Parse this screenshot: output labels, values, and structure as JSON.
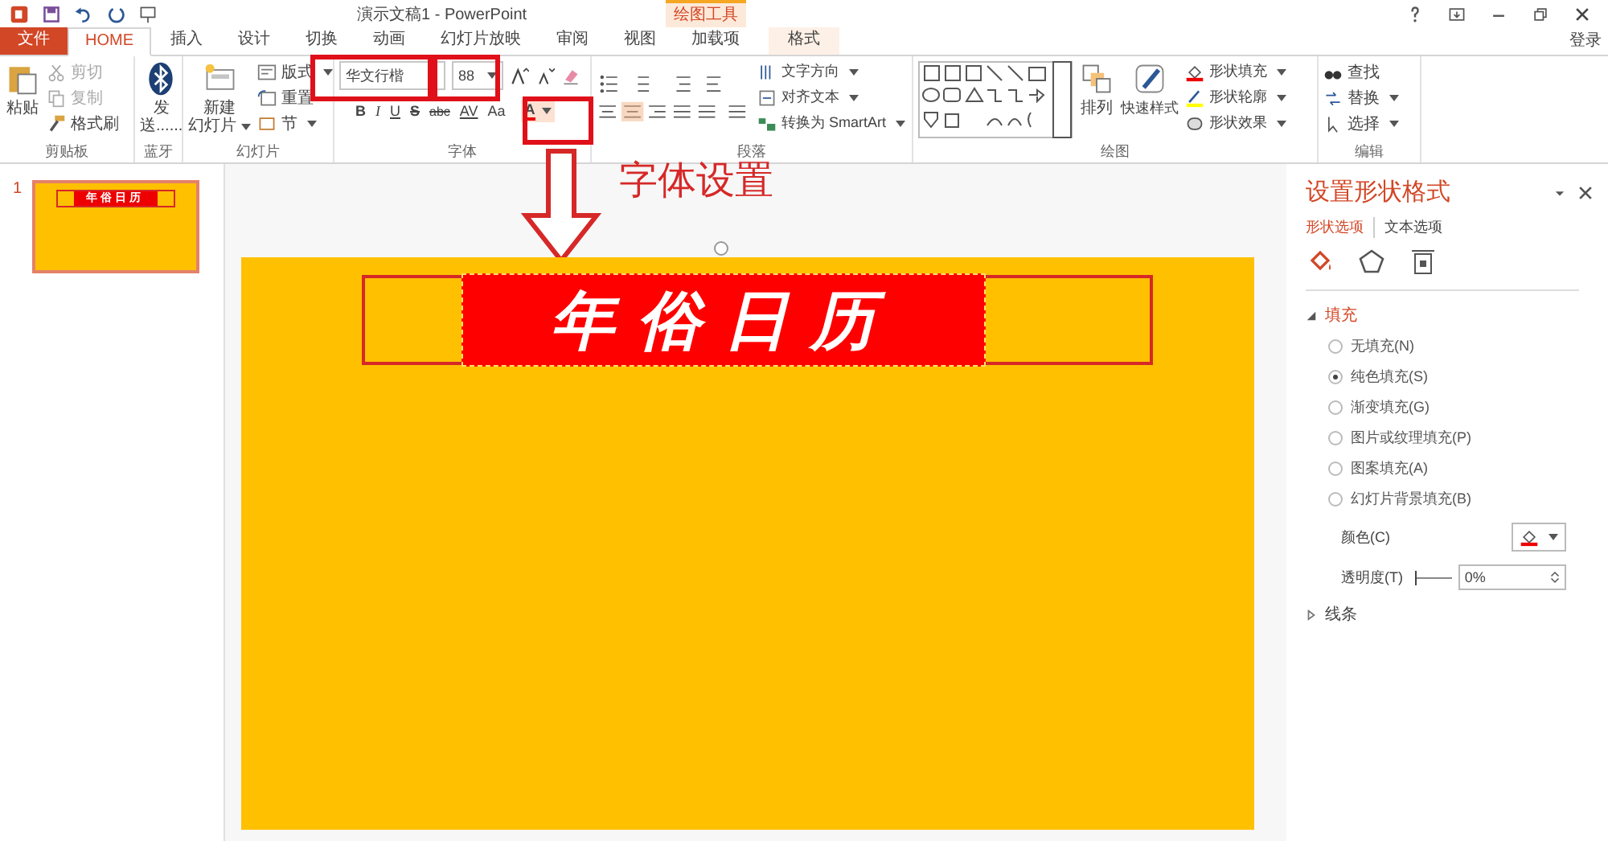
{
  "title_bar": {
    "title": "演示文稿1 - PowerPoint",
    "contextual_header": "绘图工具",
    "login": "登录"
  },
  "tabs": [
    {
      "label": "文件",
      "kind": "file",
      "selected": false
    },
    {
      "label": "HOME",
      "kind": "normal",
      "selected": true
    },
    {
      "label": "插入",
      "kind": "normal",
      "selected": false
    },
    {
      "label": "设计",
      "kind": "normal",
      "selected": false
    },
    {
      "label": "切换",
      "kind": "normal",
      "selected": false
    },
    {
      "label": "动画",
      "kind": "normal",
      "selected": false
    },
    {
      "label": "幻灯片放映",
      "kind": "normal",
      "selected": false
    },
    {
      "label": "审阅",
      "kind": "normal",
      "selected": false
    },
    {
      "label": "视图",
      "kind": "normal",
      "selected": false
    },
    {
      "label": "加载项",
      "kind": "normal",
      "selected": false
    },
    {
      "label": "格式",
      "kind": "contextual",
      "selected": false
    }
  ],
  "ribbon": {
    "clipboard": {
      "label": "剪贴板",
      "paste": "粘贴",
      "cut": "剪切",
      "copy": "复制",
      "format_painter": "格式刷"
    },
    "bluetooth": {
      "label": "蓝牙",
      "send": "发",
      "send_more": "送......"
    },
    "slides": {
      "label": "幻灯片",
      "new_slide": "新建",
      "new_slide_2": "幻灯片",
      "layout": "版式",
      "reset": "重置",
      "section": "节"
    },
    "font": {
      "label": "字体",
      "font_name": "华文行楷",
      "font_size": "88",
      "format_buttons": [
        "B",
        "I",
        "U",
        "S",
        "abc",
        "AV",
        "Aa"
      ],
      "font_color": "A"
    },
    "paragraph": {
      "label": "段落",
      "text_direction": "文字方向",
      "align_text": "对齐文本",
      "smartart": "转换为 SmartArt"
    },
    "drawing": {
      "label": "绘图",
      "arrange": "排列",
      "quick_styles": "快速样式",
      "shape_fill": "形状填充",
      "shape_outline": "形状轮廓",
      "shape_effects": "形状效果"
    },
    "editing": {
      "label": "编辑",
      "find": "查找",
      "replace": "替换",
      "select": "选择"
    }
  },
  "thumbnails": [
    {
      "number": "1",
      "title": "年俗日历",
      "selected": true
    }
  ],
  "slide": {
    "title": "年俗日历"
  },
  "annotation": {
    "label": "字体设置"
  },
  "format_pane": {
    "title": "设置形状格式",
    "tabs": [
      {
        "label": "形状选项",
        "selected": true
      },
      {
        "label": "文本选项",
        "selected": false
      }
    ],
    "fill": {
      "label": "填充",
      "expanded": true,
      "options": [
        {
          "label": "无填充(N)",
          "selected": false
        },
        {
          "label": "纯色填充(S)",
          "selected": true
        },
        {
          "label": "渐变填充(G)",
          "selected": false
        },
        {
          "label": "图片或纹理填充(P)",
          "selected": false
        },
        {
          "label": "图案填充(A)",
          "selected": false
        },
        {
          "label": "幻灯片背景填充(B)",
          "selected": false
        }
      ],
      "color_label": "颜色(C)",
      "transparency_label": "透明度(T)",
      "transparency_value": "0%",
      "transparency": {
        "level": 0
      }
    },
    "line": {
      "label": "线条",
      "expanded": false
    }
  }
}
